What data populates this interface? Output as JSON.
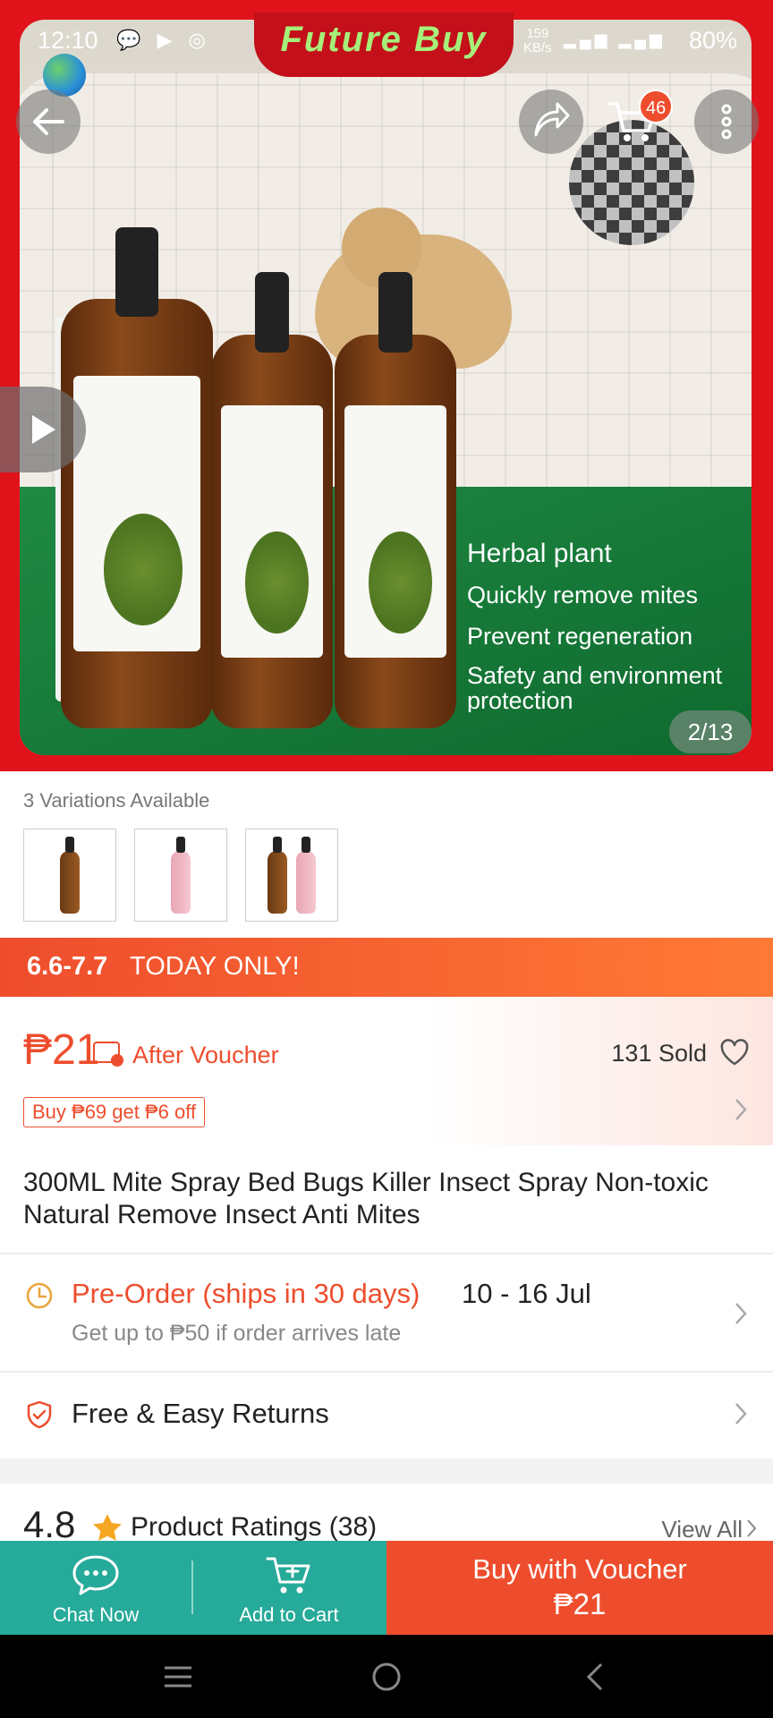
{
  "status_bar": {
    "time": "12:10",
    "net_speed": "159",
    "net_unit": "KB/s",
    "battery": "80%"
  },
  "brand": {
    "name": "Future Buy"
  },
  "hero": {
    "cart_count": "46",
    "image_text": [
      "Herbal plant",
      "Quickly remove mites",
      "Prevent regeneration",
      "Safety and environment",
      "protection"
    ],
    "page_counter": "2/13"
  },
  "variations": {
    "label": "3 Variations Available",
    "count": 3
  },
  "promo": {
    "date": "6.6-7.7",
    "text": "TODAY ONLY!"
  },
  "price": {
    "amount": "₱21",
    "after_voucher": "After Voucher",
    "sold": "131 Sold",
    "deal_tag": "Buy ₱69 get ₱6 off"
  },
  "product": {
    "title": "300ML Mite Spray Bed Bugs Killer Insect Spray Non-toxic Natural Remove Insect Anti Mites"
  },
  "shipping": {
    "preorder": "Pre-Order (ships in 30 days)",
    "dates": "10 - 16 Jul",
    "late_note": "Get up to ₱50 if order arrives late"
  },
  "returns": {
    "label": "Free & Easy Returns"
  },
  "ratings": {
    "score": "4.8",
    "label": "Product Ratings (38)",
    "view_all": "View All"
  },
  "bottom_bar": {
    "chat_label": "Chat Now",
    "cart_label": "Add to Cart",
    "buy_label": "Buy with Voucher",
    "buy_price": "₱21"
  },
  "colors": {
    "accent": "#ee4d2d",
    "teal": "#26aa99",
    "frame_red": "#e0131b"
  }
}
